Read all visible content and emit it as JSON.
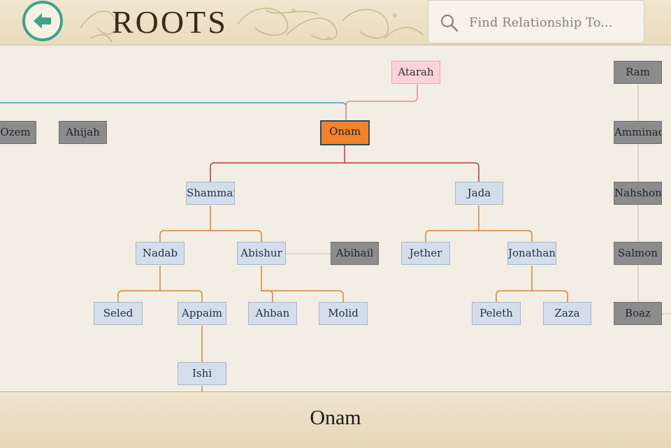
{
  "header": {
    "title": "ROOTS",
    "back_icon": "arrow-left-icon",
    "search": {
      "placeholder": "Find Relationship To...",
      "value": ""
    }
  },
  "tree": {
    "nodes": {
      "atarah": "Atarah",
      "ozem": "Ozem",
      "ahijah": "Ahijah",
      "onam": "Onam",
      "shammai": "Shammai",
      "jada": "Jada",
      "nadab": "Nadab",
      "abishur": "Abishur",
      "abihail": "Abihail",
      "jether": "Jether",
      "jonathan": "Jonathan",
      "seled": "Seled",
      "appaim": "Appaim",
      "ahban": "Ahban",
      "molid": "Molid",
      "peleth": "Peleth",
      "zaza": "Zaza",
      "ishi": "Ishi",
      "ram": "Ram",
      "amminadab": "Amminad",
      "nahshon": "Nahshon",
      "salmon": "Salmon",
      "boaz": "Boaz"
    },
    "selected": "onam"
  },
  "footer": {
    "selected_name": "Onam"
  },
  "colors": {
    "accent": "#3aa58b",
    "selected": "#f28328",
    "parent_line": "#e3878a",
    "child_line_red": "#c9353a",
    "child_line_orange": "#d9833a",
    "sibling_line": "#4a9ad0"
  }
}
